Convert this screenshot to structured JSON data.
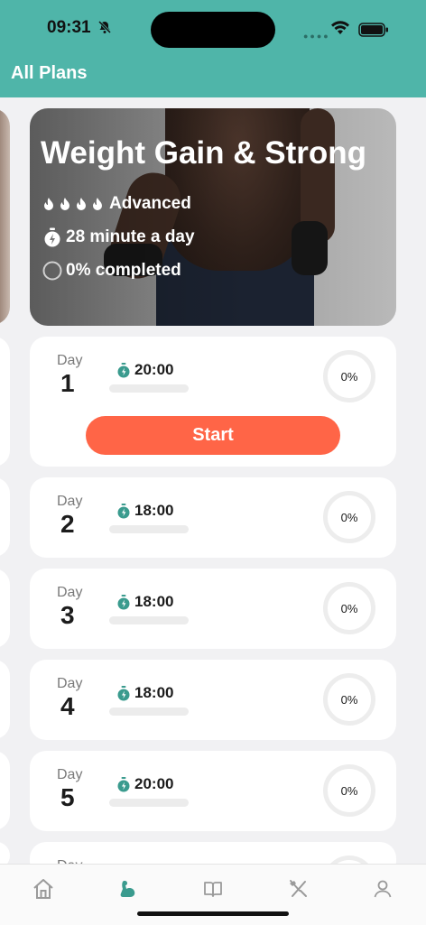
{
  "status_bar": {
    "time": "09:31"
  },
  "header": {
    "title": "All Plans"
  },
  "plan": {
    "title": "Weight Gain & Strong",
    "level": "Advanced",
    "duration": "28 minute a day",
    "completed": "0% completed"
  },
  "days": [
    {
      "label": "Day",
      "number": "1",
      "time": "20:00",
      "percent": "0%",
      "button": "Start"
    },
    {
      "label": "Day",
      "number": "2",
      "time": "18:00",
      "percent": "0%"
    },
    {
      "label": "Day",
      "number": "3",
      "time": "18:00",
      "percent": "0%"
    },
    {
      "label": "Day",
      "number": "4",
      "time": "18:00",
      "percent": "0%"
    },
    {
      "label": "Day",
      "number": "5",
      "time": "20:00",
      "percent": "0%"
    },
    {
      "label": "Day"
    }
  ],
  "colors": {
    "header": "#4fb5a9",
    "accent": "#ff6547",
    "active_tab": "#3a9b8e"
  },
  "tabbar": {
    "items": [
      {
        "icon": "home-icon",
        "active": false
      },
      {
        "icon": "muscle-icon",
        "active": true
      },
      {
        "icon": "book-icon",
        "active": false
      },
      {
        "icon": "utensils-icon",
        "active": false
      },
      {
        "icon": "profile-icon",
        "active": false
      }
    ]
  }
}
